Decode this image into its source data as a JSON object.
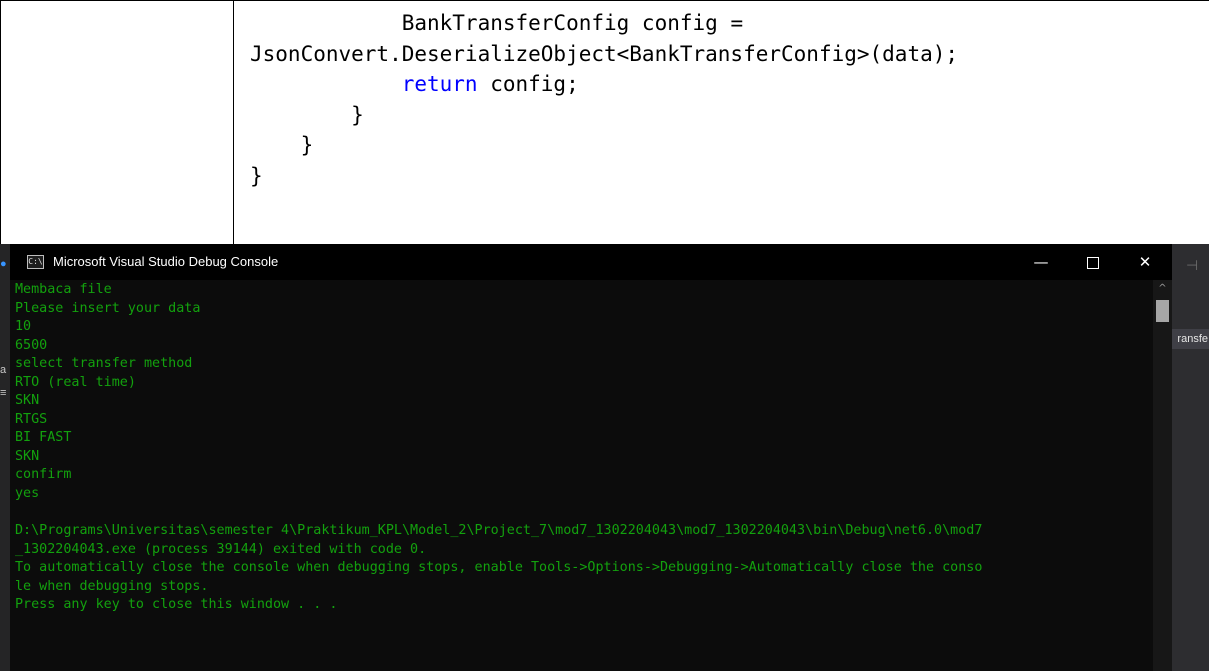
{
  "document": {
    "code_lines": [
      {
        "indent": "            ",
        "text": "BankTransferConfig config ="
      },
      {
        "indent": "",
        "text": "JsonConvert.DeserializeObject<BankTransferConfig>(data);"
      },
      {
        "indent": "            ",
        "keyword": "return",
        "text": " config;"
      },
      {
        "indent": "        ",
        "text": "}"
      },
      {
        "indent": "    ",
        "text": "}"
      },
      {
        "indent": "",
        "text": "}"
      }
    ]
  },
  "console": {
    "title": "Microsoft Visual Studio Debug Console",
    "icon_label": "C:\\",
    "buttons": {
      "minimize": "—",
      "maximize": "",
      "close": "✕"
    },
    "output_lines": [
      "Membaca file",
      "Please insert your data",
      "10",
      "6500",
      "select transfer method",
      "RTO (real time)",
      "SKN",
      "RTGS",
      "BI FAST",
      "SKN",
      "confirm",
      "yes",
      "",
      "D:\\Programs\\Universitas\\semester 4\\Praktikum_KPL\\Model_2\\Project_7\\mod7_1302204043\\mod7_1302204043\\bin\\Debug\\net6.0\\mod7",
      "_1302204043.exe (process 39144) exited with code 0.",
      "To automatically close the console when debugging stops, enable Tools->Options->Debugging->Automatically close the conso",
      "le when debugging stops.",
      "Press any key to close this window . . ."
    ],
    "colors": {
      "text": "#13a10e",
      "background": "#0c0c0c",
      "titlebar": "#000000"
    }
  },
  "background_window": {
    "right_peek_label": "ransfe"
  }
}
